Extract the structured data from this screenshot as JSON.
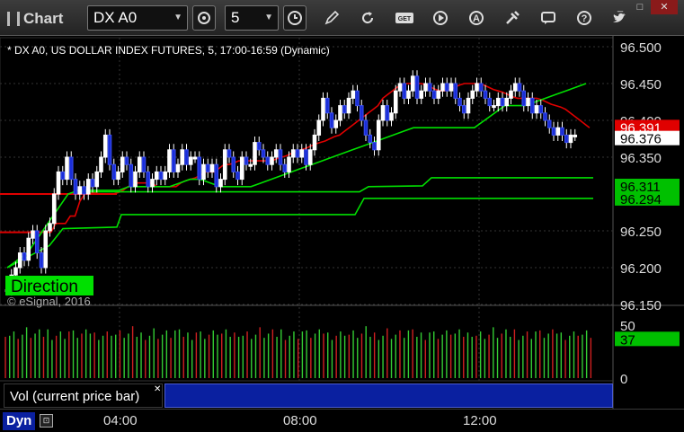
{
  "app": {
    "title": "Chart"
  },
  "toolbar": {
    "symbol": "DX A0",
    "interval": "5",
    "icons": [
      "gear-icon",
      "clock-icon",
      "pencil-icon",
      "refresh-icon",
      "get-icon",
      "play-icon",
      "alert-icon",
      "tools-icon",
      "chat-icon",
      "info-icon",
      "twitter-icon"
    ]
  },
  "window": {
    "minimize": "_",
    "maximize": "□",
    "close": "✕"
  },
  "chart_data": {
    "type": "candlestick",
    "title": "* DX A0, US DOLLAR INDEX FUTURES, 5, 17:00-16:59 (Dynamic)",
    "watermark": "© eSignal, 2016",
    "annotation": "Direction",
    "ylim": [
      96.15,
      96.5
    ],
    "y_ticks": [
      "96.500",
      "96.450",
      "96.400",
      "96.350",
      "96.250",
      "96.200",
      "96.150"
    ],
    "x_ticks": [
      "04:00",
      "08:00",
      "12:00"
    ],
    "price_tags": [
      {
        "label": "96.391",
        "value": 96.391,
        "bg": "#e00000",
        "color": "#ffffff"
      },
      {
        "label": "96.376",
        "value": 96.376,
        "bg": "#ffffff",
        "color": "#000000"
      },
      {
        "label": "96.311",
        "value": 96.311,
        "bg": "#00c000",
        "color": "#000000"
      },
      {
        "label": "96.294",
        "value": 96.294,
        "bg": "#00c000",
        "color": "#000000"
      }
    ],
    "series": [
      {
        "name": "Close",
        "values": [
          96.17,
          96.19,
          96.2,
          96.22,
          96.21,
          96.24,
          96.25,
          96.22,
          96.2,
          96.25,
          96.26,
          96.3,
          96.33,
          96.32,
          96.35,
          96.32,
          96.3,
          96.31,
          96.3,
          96.32,
          96.31,
          96.33,
          96.35,
          96.38,
          96.34,
          96.32,
          96.33,
          96.35,
          96.34,
          96.31,
          96.33,
          96.35,
          96.33,
          96.31,
          96.32,
          96.33,
          96.32,
          96.33,
          96.36,
          96.33,
          96.34,
          96.36,
          96.34,
          96.35,
          96.35,
          96.32,
          96.34,
          96.33,
          96.34,
          96.31,
          96.32,
          96.36,
          96.35,
          96.33,
          96.32,
          96.35,
          96.34,
          96.34,
          96.37,
          96.36,
          96.35,
          96.34,
          96.35,
          96.36,
          96.34,
          96.33,
          96.35,
          96.36,
          96.35,
          96.36,
          96.34,
          96.36,
          96.38,
          96.4,
          96.43,
          96.41,
          96.39,
          96.4,
          96.42,
          96.41,
          96.43,
          96.44,
          96.42,
          96.4,
          96.38,
          96.37,
          96.36,
          96.4,
          96.42,
          96.4,
          96.41,
          96.44,
          96.45,
          96.43,
          96.44,
          96.46,
          96.43,
          96.44,
          96.45,
          96.44,
          96.43,
          96.44,
          96.45,
          96.44,
          96.45,
          96.43,
          96.42,
          96.41,
          96.43,
          96.44,
          96.45,
          96.44,
          96.43,
          96.42,
          96.42,
          96.43,
          96.42,
          96.43,
          96.44,
          96.45,
          96.44,
          96.42,
          96.43,
          96.41,
          96.42,
          96.41,
          96.4,
          96.39,
          96.38,
          96.39,
          96.38,
          96.37,
          96.38,
          96.38
        ]
      },
      {
        "name": "Upper Band",
        "values": [
          96.248,
          96.248,
          96.248,
          96.248,
          96.248,
          96.248,
          96.26,
          96.26,
          96.26,
          96.27,
          96.27,
          96.29,
          96.3,
          96.3,
          96.302,
          96.3,
          96.3,
          96.3,
          96.3,
          96.302,
          96.305,
          96.31,
          96.312,
          96.315,
          96.315,
          96.315,
          96.315,
          96.31,
          96.31,
          96.31,
          96.31,
          96.31,
          96.315,
          96.318,
          96.32,
          96.322,
          96.325,
          96.33,
          96.33,
          96.33,
          96.335,
          96.34,
          96.34,
          96.342,
          96.345,
          96.345,
          96.345,
          96.345,
          96.345,
          96.345,
          96.345,
          96.345,
          96.348,
          96.35,
          96.352,
          96.355,
          96.358,
          96.36,
          96.362,
          96.365,
          96.368,
          96.37,
          96.372,
          96.375,
          96.378,
          96.38,
          96.385,
          96.39,
          96.395,
          96.4,
          96.405,
          96.41,
          96.415,
          96.42,
          96.43,
          96.435,
          96.44,
          96.445,
          96.448,
          96.45,
          96.45,
          96.45,
          96.45,
          96.448,
          96.445,
          96.442,
          96.44,
          96.44,
          96.442,
          96.445,
          96.448,
          96.45,
          96.45,
          96.45,
          96.45,
          96.448,
          96.445,
          96.442,
          96.44,
          96.438,
          96.435,
          96.432,
          96.43,
          96.43,
          96.43,
          96.43,
          96.43,
          96.428,
          96.425,
          96.422,
          96.42,
          96.418,
          96.415,
          96.41,
          96.405,
          96.4,
          96.395,
          96.39
        ]
      },
      {
        "name": "Mid Band",
        "values": [
          96.2,
          96.21,
          96.22,
          96.24,
          96.26,
          96.28,
          96.3,
          96.305,
          96.305,
          96.305,
          96.305,
          96.305,
          96.31,
          96.31,
          96.31,
          96.31,
          96.31,
          96.315,
          96.32,
          96.32,
          96.315,
          96.31,
          96.31,
          96.31,
          96.31,
          96.315,
          96.32,
          96.325,
          96.33,
          96.335,
          96.34,
          96.345,
          96.35,
          96.355,
          96.36,
          96.365,
          96.37,
          96.375,
          96.38,
          96.385,
          96.39,
          96.39,
          96.39,
          96.39,
          96.39,
          96.39,
          96.39,
          96.4,
          96.41,
          96.42,
          96.42,
          96.42,
          96.425,
          96.43,
          96.435,
          96.44,
          96.445,
          96.45
        ]
      },
      {
        "name": "Lower Band",
        "values": [
          96.294,
          96.294,
          96.294,
          96.294,
          96.294,
          96.294,
          96.294,
          96.294,
          96.294,
          96.294,
          96.294,
          96.294,
          96.294,
          96.294,
          96.294,
          96.294,
          96.294,
          96.294,
          96.294,
          96.294,
          96.294,
          96.294,
          96.294,
          96.294,
          96.294,
          96.294,
          96.294,
          96.294,
          96.294,
          96.294,
          96.294,
          96.294,
          96.294
        ]
      },
      {
        "name": "Support",
        "values": [
          96.27,
          96.27,
          96.27,
          96.27,
          96.27,
          96.27,
          96.27,
          96.27,
          96.27,
          96.27,
          96.27,
          96.27,
          96.27,
          96.27,
          96.27,
          96.27,
          96.27,
          96.27,
          96.27,
          96.27,
          96.27,
          96.27,
          96.27,
          96.27,
          96.27,
          96.27,
          96.27
        ]
      }
    ],
    "volume": {
      "label": "Vol (current price bar)",
      "ylim": [
        0,
        50
      ],
      "y_ticks": [
        "50",
        "0"
      ],
      "current_tag": "37"
    }
  },
  "bottom": {
    "mode": "Dyn",
    "lock": "⊡"
  }
}
